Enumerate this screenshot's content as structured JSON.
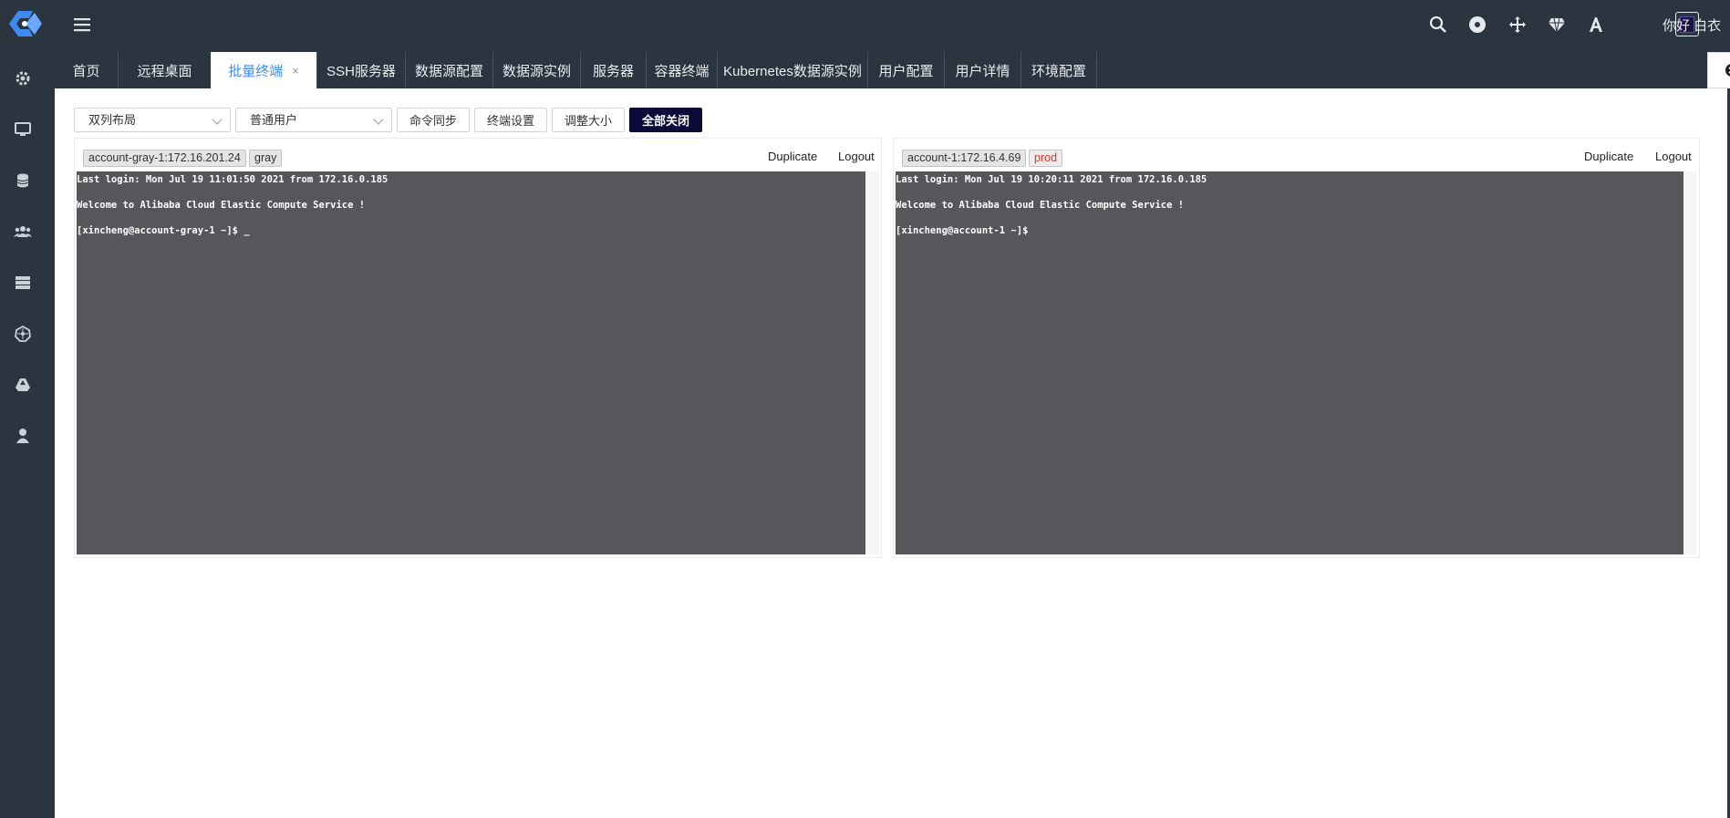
{
  "header": {
    "greeting": "你好 白衣",
    "icons": [
      "search-icon",
      "record-icon",
      "move-icon",
      "diamond-icon",
      "font-icon",
      "theme-icon"
    ]
  },
  "sidebar": {
    "icons": [
      "settings-icon",
      "monitor-icon",
      "database-icon",
      "users-icon",
      "server-icon",
      "kubernetes-icon",
      "drive-icon",
      "user-icon"
    ]
  },
  "tabs": [
    {
      "label": "首页"
    },
    {
      "label": "远程桌面"
    },
    {
      "label": "批量终端",
      "close": "×"
    },
    {
      "label": "SSH服务器"
    },
    {
      "label": "数据源配置"
    },
    {
      "label": "数据源实例"
    },
    {
      "label": "服务器"
    },
    {
      "label": "容器终端"
    },
    {
      "label": "Kubernetes数据源实例"
    },
    {
      "label": "用户配置"
    },
    {
      "label": "用户详情"
    },
    {
      "label": "环境配置"
    }
  ],
  "toolbar": {
    "layout_select": "双列布局",
    "user_select": "普通用户",
    "sync_btn": "命令同步",
    "settings_btn": "终端设置",
    "resize_btn": "调整大小",
    "close_all_btn": "全部关闭"
  },
  "terminals": [
    {
      "host": "account-gray-1:172.16.201.24",
      "env": "gray",
      "duplicate": "Duplicate",
      "logout": "Logout",
      "lines": [
        "Last login: Mon Jul 19 11:01:50 2021 from 172.16.0.185",
        "Welcome to Alibaba Cloud Elastic Compute Service !",
        "[xincheng@account-gray-1 ~]$ _"
      ]
    },
    {
      "host": "account-1:172.16.4.69",
      "env": "prod",
      "duplicate": "Duplicate",
      "logout": "Logout",
      "lines": [
        "Last login: Mon Jul 19 10:20:11 2021 from 172.16.0.185",
        "Welcome to Alibaba Cloud Elastic Compute Service !",
        "[xincheng@account-1 ~]$"
      ]
    }
  ],
  "colors": {
    "chrome": "#2b3540",
    "accent": "#3c8cff",
    "primary_button": "#0d0a3a",
    "terminal_bg": "#55575b",
    "prod_tag": "#d83a2e"
  }
}
